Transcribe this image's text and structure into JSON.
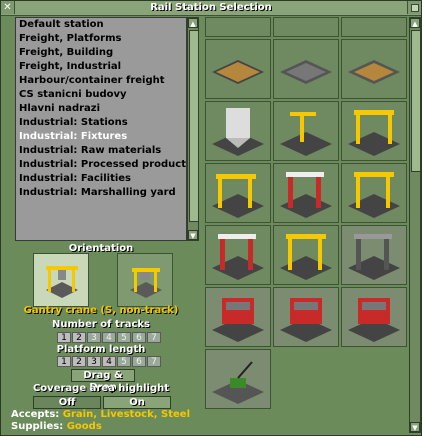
{
  "window": {
    "title": "Rail Station Selection"
  },
  "classes": [
    "Default station",
    "Freight, Platforms",
    "Freight, Building",
    "Freight, Industrial",
    "Harbour/container freight",
    "CS stanicni budovy",
    "Hlavni nadrazi",
    "Industrial: Stations",
    "Industrial: Fixtures",
    "Industrial: Raw materials",
    "Industrial: Processed products",
    "Industrial: Facilities",
    "Industrial: Marshalling yard"
  ],
  "selected_class": "Industrial: Fixtures",
  "orientation": {
    "label": "Orientation"
  },
  "station_name": "Gantry crane (S, non-track)",
  "tracks": {
    "label": "Number of tracks",
    "options": [
      "1",
      "2",
      "3",
      "4",
      "5",
      "6",
      "7"
    ]
  },
  "platform": {
    "label": "Platform length",
    "options": [
      "1",
      "2",
      "3",
      "4",
      "5",
      "6",
      "7"
    ]
  },
  "drag_drop": "Drag & Drop",
  "coverage": {
    "label": "Coverage area highlight",
    "off": "Off",
    "on": "On"
  },
  "accepts": {
    "label": "Accepts:",
    "value": "Grain, Livestock, Steel"
  },
  "supplies": {
    "label": "Supplies:",
    "value": "Goods"
  },
  "colors": {
    "accent": "#f5c800",
    "panel": "#6c8b5b"
  }
}
